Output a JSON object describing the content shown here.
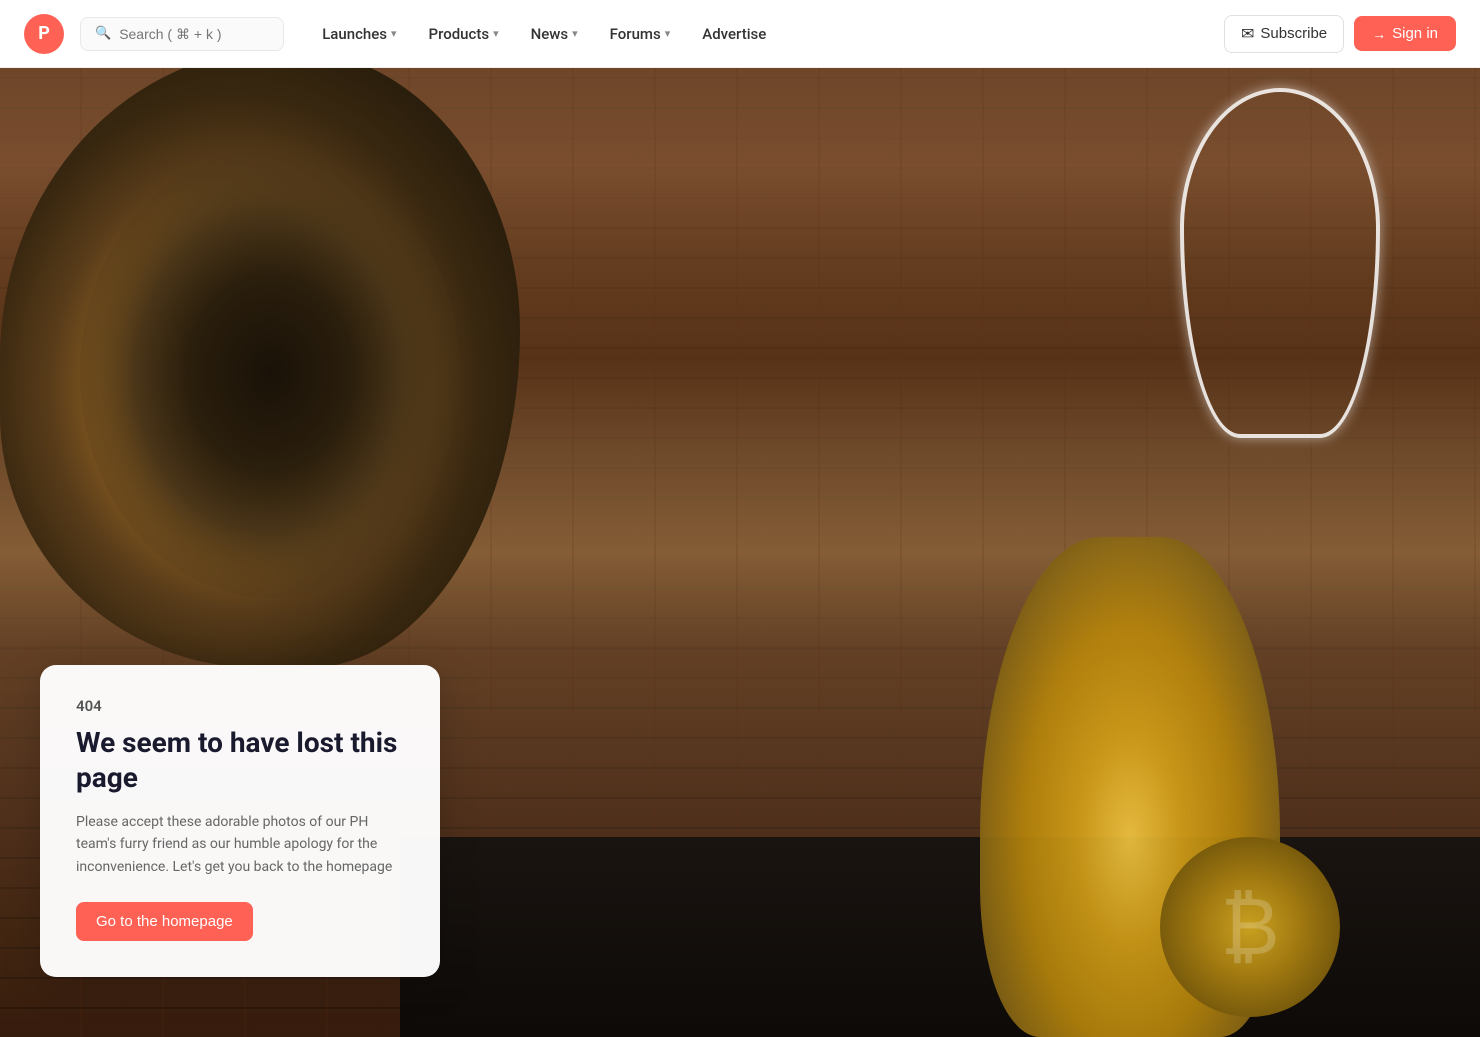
{
  "nav": {
    "logo_letter": "P",
    "search_placeholder": "Search ( ⌘ + k )",
    "links": [
      {
        "label": "Launches",
        "has_dropdown": true
      },
      {
        "label": "Products",
        "has_dropdown": true
      },
      {
        "label": "News",
        "has_dropdown": true
      },
      {
        "label": "Forums",
        "has_dropdown": true
      },
      {
        "label": "Advertise",
        "has_dropdown": false
      }
    ],
    "subscribe_label": "Subscribe",
    "signin_label": "Sign in"
  },
  "error": {
    "code": "404",
    "title": "We seem to have lost this page",
    "description": "Please accept these adorable photos of our PH team's furry friend as our humble apology for the inconvenience. Let's get you back to the homepage",
    "cta_label": "Go to the homepage"
  },
  "colors": {
    "accent": "#ff6154",
    "text_dark": "#1a1a2e",
    "text_muted": "#666"
  }
}
